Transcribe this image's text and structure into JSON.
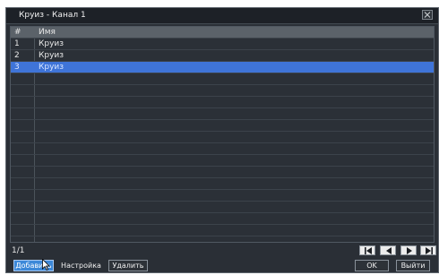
{
  "window": {
    "title": "Круиз - Канал 1"
  },
  "table": {
    "columns": [
      "#",
      "Имя"
    ],
    "rows": [
      {
        "num": "1",
        "name": "Круиз"
      },
      {
        "num": "2",
        "name": "Круиз"
      },
      {
        "num": "3",
        "name": "Круиз"
      }
    ],
    "selected_index": 2
  },
  "pagination": {
    "page_text": "1/1"
  },
  "nav_icons": [
    "first-page-icon",
    "prev-page-icon",
    "next-page-icon",
    "last-page-icon"
  ],
  "buttons": {
    "add": "Добавить",
    "settings": "Настройка",
    "delete": "Удалить",
    "ok": "OK",
    "exit": "Выйти"
  },
  "colors": {
    "selection": "#3f74d8",
    "primary_button": "#3c88d8",
    "window_bg": "#2a2f36"
  }
}
